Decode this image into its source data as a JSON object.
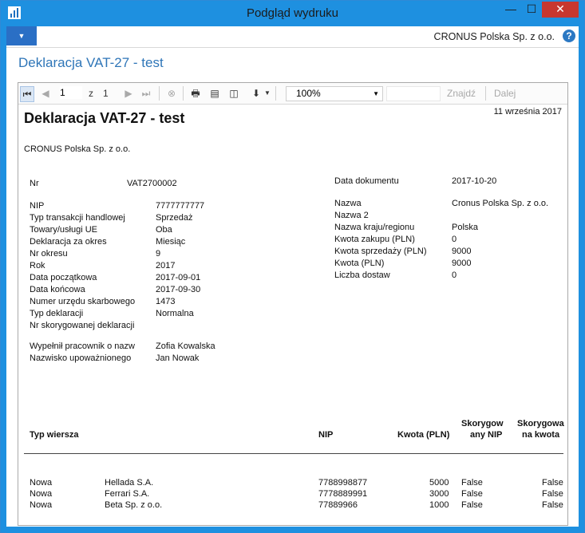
{
  "window": {
    "title": "Podgląd wydruku",
    "min_glyph": "—",
    "max_glyph": "☐",
    "close_glyph": "✕"
  },
  "ribbon": {
    "menu_glyph": "▼",
    "company": "CRONUS Polska Sp. z o.o.",
    "help_glyph": "?"
  },
  "page_title": "Deklaracja VAT-27 - test",
  "toolbar": {
    "page_current": "1",
    "page_of": "z",
    "page_total": "1",
    "zoom": "100%",
    "find": "Znajdź",
    "next": "Dalej"
  },
  "report": {
    "title": "Deklaracja VAT-27 - test",
    "date_printed": "11 września 2017",
    "company": "CRONUS Polska Sp. z o.o.",
    "left_fields": [
      {
        "label": "Nr",
        "value": "VAT2700002"
      },
      {
        "label": "NIP",
        "value": "7777777777"
      },
      {
        "label": "Typ transakcji handlowej",
        "value": "Sprzedaż"
      },
      {
        "label": "Towary/usługi UE",
        "value": "Oba"
      },
      {
        "label": "Deklaracja za okres",
        "value": "Miesiąc"
      },
      {
        "label": "Nr okresu",
        "value": "9"
      },
      {
        "label": "Rok",
        "value": "2017"
      },
      {
        "label": "Data początkowa",
        "value": "2017-09-01"
      },
      {
        "label": "Data końcowa",
        "value": "2017-09-30"
      },
      {
        "label": "Numer urzędu skarbowego",
        "value": "1473"
      },
      {
        "label": "Typ deklaracji",
        "value": "Normalna"
      },
      {
        "label": "Nr skorygowanej deklaracji",
        "value": ""
      },
      {
        "label": "Wypełnił pracownik o nazw",
        "value": "Zofia Kowalska"
      },
      {
        "label": "Nazwisko upoważnionego",
        "value": "Jan Nowak"
      }
    ],
    "right_fields": [
      {
        "label": "Data dokumentu",
        "value": "2017-10-20"
      },
      {
        "label": "Nazwa",
        "value": "Cronus Polska Sp. z o.o."
      },
      {
        "label": "Nazwa 2",
        "value": ""
      },
      {
        "label": "Nazwa kraju/regionu",
        "value": "Polska"
      },
      {
        "label": "Kwota zakupu (PLN)",
        "value": "0"
      },
      {
        "label": "Kwota sprzedaży (PLN)",
        "value": "9000"
      },
      {
        "label": "Kwota (PLN)",
        "value": "9000"
      },
      {
        "label": "Liczba dostaw",
        "value": "0"
      }
    ],
    "table": {
      "headers": {
        "type": "Typ wiersza",
        "nip": "NIP",
        "amount": "Kwota (PLN)",
        "corr_nip_1": "Skorygow",
        "corr_nip_2": "any NIP",
        "corr_amt_1": "Skorygowa",
        "corr_amt_2": "na kwota"
      },
      "rows": [
        {
          "type": "Nowa",
          "name": "Hellada S.A.",
          "nip": "7788998877",
          "amount": "5000",
          "corr_nip": "False",
          "corr_amount": "False"
        },
        {
          "type": "Nowa",
          "name": "Ferrari S.A.",
          "nip": "7778889991",
          "amount": "3000",
          "corr_nip": "False",
          "corr_amount": "False"
        },
        {
          "type": "Nowa",
          "name": "Beta Sp. z o.o.",
          "nip": "77889966",
          "amount": "1000",
          "corr_nip": "False",
          "corr_amount": "False"
        }
      ]
    }
  }
}
